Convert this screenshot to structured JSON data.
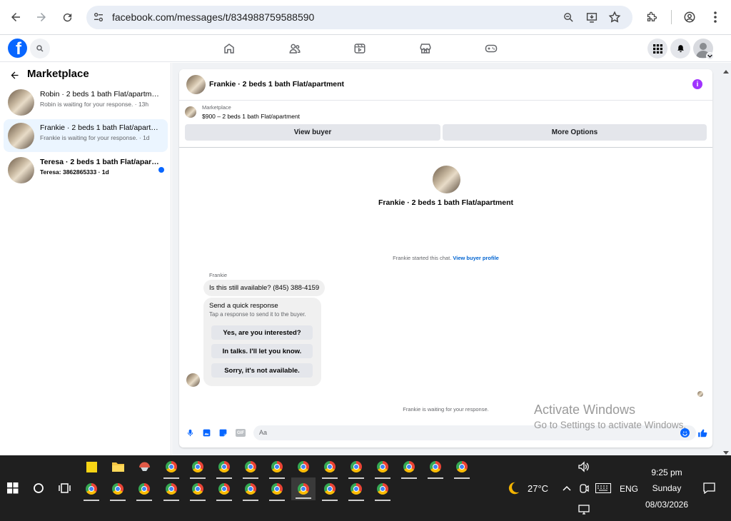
{
  "browser": {
    "url": "facebook.com/messages/t/834988759588590",
    "icons": [
      "back-arrow-icon",
      "forward-arrow-icon",
      "reload-icon",
      "site-info-icon",
      "zoom-icon",
      "install-icon",
      "star-icon",
      "extensions-icon",
      "profile-icon",
      "more-icon"
    ]
  },
  "fb": {
    "nav_icons": [
      "home-icon",
      "friends-icon",
      "watch-icon",
      "marketplace-icon",
      "gaming-icon"
    ],
    "right_icons": [
      "menu-grid-icon",
      "bell-icon",
      "account-avatar-icon"
    ]
  },
  "sidebar": {
    "title": "Marketplace",
    "conversations": [
      {
        "title": "Robin · 2 beds 1 bath Flat/apartment",
        "subtitle": "Robin is waiting for your response. · 13h"
      },
      {
        "title": "Frankie · 2 beds 1 bath Flat/apartment",
        "subtitle": "Frankie is waiting for your response. · 1d"
      },
      {
        "title": "Teresa · 2 beds 1 bath Flat/apartment",
        "subtitle": "Teresa: 3862865333 · 1d"
      }
    ]
  },
  "chat": {
    "header_title": "Frankie · 2 beds 1 bath Flat/apartment",
    "listing_source": "Marketplace",
    "listing_detail": "$900 – 2 beds 1 bath Flat/apartment",
    "view_buyer": "View buyer",
    "more_options": "More Options",
    "profile_name": "Frankie · 2 beds 1 bath Flat/apartment",
    "started_text": "Frankie started this chat.",
    "view_buyer_profile": "View buyer profile",
    "sender": "Frankie",
    "message": "Is this still available? (845) 388-4159",
    "quick_title": "Send a quick response",
    "quick_sub": "Tap a response to send it to the buyer.",
    "quick_responses": [
      "Yes, are you interested?",
      "In talks. I'll let you know.",
      "Sorry, it's not available."
    ],
    "waiting_text": "Frankie is waiting for your response.",
    "input_placeholder": "Aa"
  },
  "watermark": {
    "line1": "Activate Windows",
    "line2": "Go to Settings to activate Windows."
  },
  "taskbar": {
    "weather": "27°C",
    "lang": "ENG",
    "time": "9:25 pm",
    "day": "Sunday",
    "date": "08/03/2026"
  },
  "colors": {
    "fb_blue": "#0866ff",
    "accent_purple": "#a033ff"
  }
}
